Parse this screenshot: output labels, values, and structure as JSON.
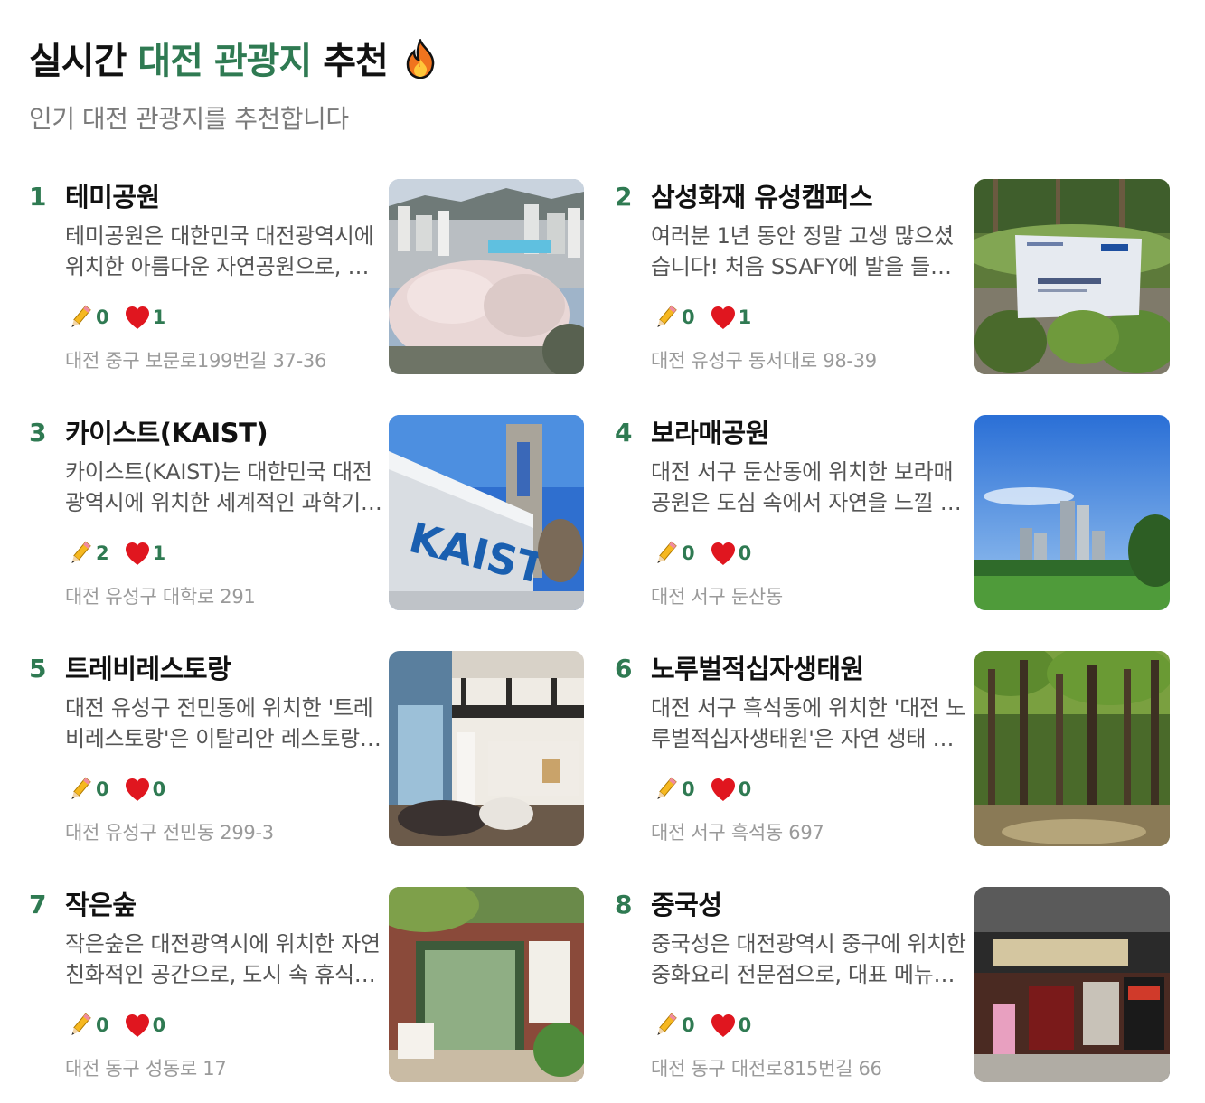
{
  "header": {
    "title_prefix": "실시간",
    "title_accent": "대전 관광지",
    "title_suffix": "추천",
    "title_icon": "fire-icon",
    "subtitle": "인기 대전 관광지를 추천합니다"
  },
  "colors": {
    "accent": "#2f7a52",
    "heart": "#e0161f",
    "muted": "#9a9a9a"
  },
  "places": [
    {
      "rank": "1",
      "name": "테미공원",
      "desc": "테미공원은 대한민국 대전광역시에 위치한 아름다운 자연공원으로, 벚꽃 명소로 유명합니다.",
      "reviews": "0",
      "likes": "1",
      "address": "대전 중구 보문로199번길 37-36",
      "image": "cherry-blossom-city-photo"
    },
    {
      "rank": "2",
      "name": "삼성화재 유성캠퍼스",
      "desc": "여러분 1년 동안 정말 고생 많으셨습니다! 처음 SSAFY에 발을 들였을 때를 기억하시나요?",
      "reviews": "0",
      "likes": "1",
      "address": "대전 유성구 동서대로 98-39",
      "image": "samsung-campus-sign-photo"
    },
    {
      "rank": "3",
      "name": "카이스트(KAIST)",
      "desc": "카이스트(KAIST)는 대한민국 대전광역시에 위치한 세계적인 과학기술 연구중심 대학입니다.",
      "reviews": "2",
      "likes": "1",
      "address": "대전 유성구 대학로 291",
      "image": "kaist-gate-photo"
    },
    {
      "rank": "4",
      "name": "보라매공원",
      "desc": "대전 서구 둔산동에 위치한 보라매공원은 도심 속에서 자연을 느낄 수 있는 공원입니다.",
      "reviews": "0",
      "likes": "0",
      "address": "대전 서구 둔산동",
      "image": "park-towers-photo"
    },
    {
      "rank": "5",
      "name": "트레비레스토랑",
      "desc": "대전 유성구 전민동에 위치한 '트레비레스토랑'은 이탈리안 레스토랑입니다.",
      "reviews": "0",
      "likes": "0",
      "address": "대전 유성구 전민동 299-3",
      "image": "restaurant-interior-photo"
    },
    {
      "rank": "6",
      "name": "노루벌적십자생태원",
      "desc": "대전 서구 흑석동에 위치한 '대전 노루벌적십자생태원'은 자연 생태 체험 공간입니다.",
      "reviews": "0",
      "likes": "0",
      "address": "대전 서구 흑석동 697",
      "image": "forest-trees-photo"
    },
    {
      "rank": "7",
      "name": "작은숲",
      "desc": "작은숲은 대전광역시에 위치한 자연 친화적인 공간으로, 도시 속 휴식처입니다.",
      "reviews": "0",
      "likes": "0",
      "address": "대전 동구 성동로 17",
      "image": "cafe-storefront-photo"
    },
    {
      "rank": "8",
      "name": "중국성",
      "desc": "중국성은 대전광역시 중구에 위치한 중화요리 전문점으로, 대표 메뉴가 유명합니다.",
      "reviews": "0",
      "likes": "0",
      "address": "대전 동구 대전로815번길 66",
      "image": "chinese-restaurant-facade-photo"
    }
  ]
}
